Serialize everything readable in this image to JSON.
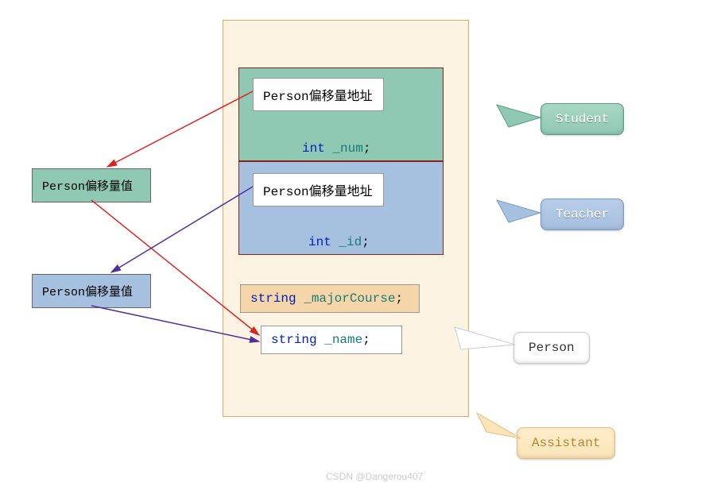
{
  "containers": {
    "assistant": "Assistant",
    "student": "Student",
    "teacher": "Teacher",
    "person": "Person"
  },
  "student": {
    "vptr_label": "Person偏移量地址",
    "member_type": "int",
    "member_name": "_num",
    "member_semi": ";"
  },
  "teacher": {
    "vptr_label": "Person偏移量地址",
    "member_type": "int",
    "member_name": "_id",
    "member_semi": ";"
  },
  "assistant_member": {
    "type": "string",
    "name": "_majorCourse",
    "semi": ";"
  },
  "person_member": {
    "type": "string",
    "name": "_name",
    "semi": ";"
  },
  "offset_tables": {
    "for_student": "Person偏移量值",
    "for_teacher": "Person偏移量值"
  },
  "watermark": "CSDN @Dangerou407"
}
